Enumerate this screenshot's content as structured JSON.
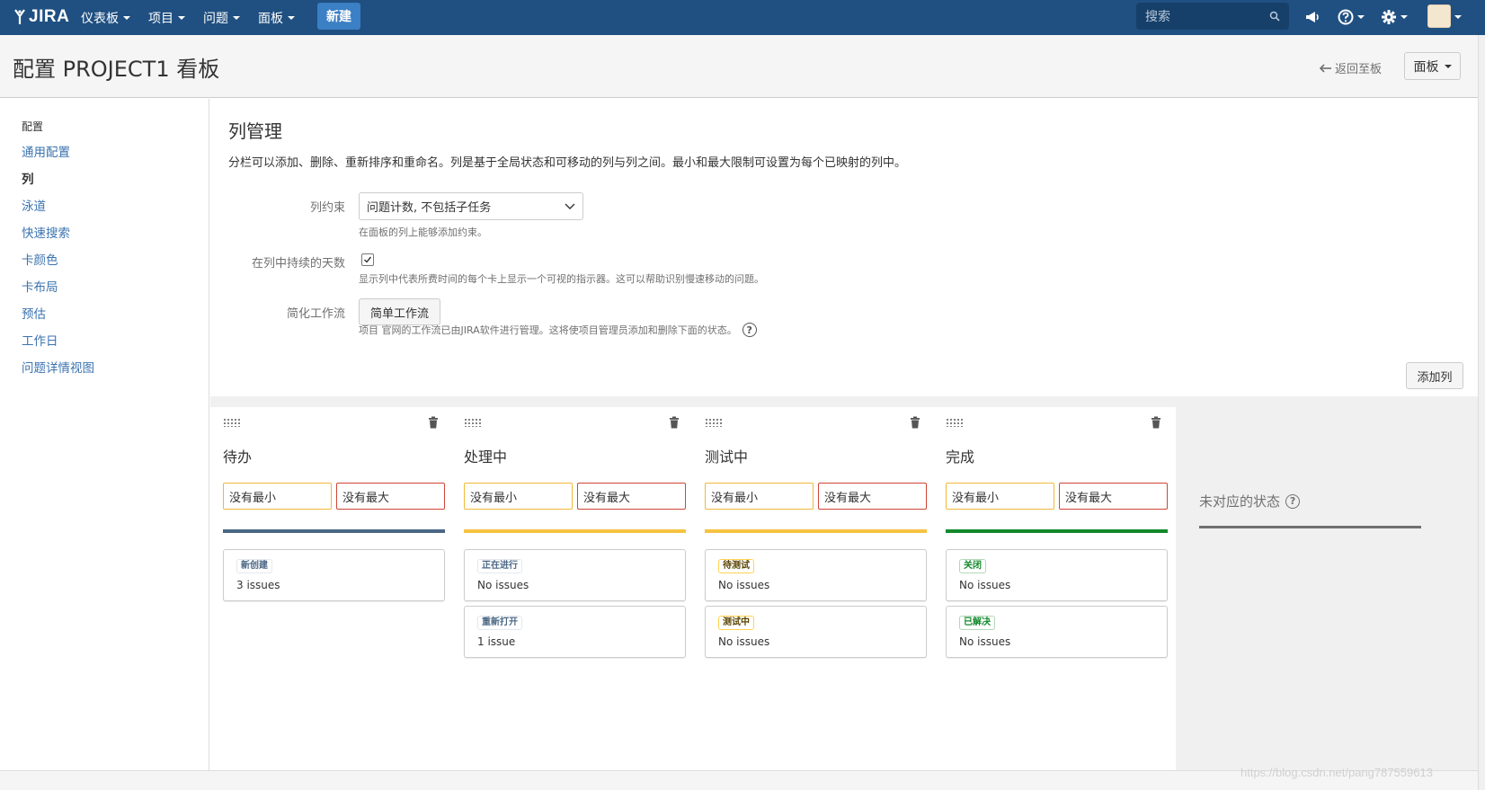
{
  "topnav": {
    "logo": "JIRA",
    "menu": [
      {
        "label": "仪表板"
      },
      {
        "label": "项目"
      },
      {
        "label": "问题"
      },
      {
        "label": "面板"
      }
    ],
    "create_label": "新建",
    "search_placeholder": "搜索"
  },
  "header": {
    "title": "配置 PROJECT1 看板",
    "back_link": "返回至板",
    "board_button": "面板"
  },
  "sidebar": {
    "heading": "配置",
    "items": [
      {
        "label": "通用配置"
      },
      {
        "label": "列"
      },
      {
        "label": "泳道"
      },
      {
        "label": "快速搜索"
      },
      {
        "label": "卡颜色"
      },
      {
        "label": "卡布局"
      },
      {
        "label": "预估"
      },
      {
        "label": "工作日"
      },
      {
        "label": "问题详情视图"
      }
    ]
  },
  "main": {
    "title": "列管理",
    "description": "分栏可以添加、删除、重新排序和重命名。列是基于全局状态和可移动的列与列之间。最小和最大限制可设置为每个已映射的列中。",
    "constraint_label": "列约束",
    "constraint_value": "问题计数, 不包括子任务",
    "constraint_help": "在面板的列上能够添加约束。",
    "days_label": "在列中持续的天数",
    "days_help": "显示列中代表所费时间的每个卡上显示一个可视的指示器。这可以帮助识别慢速移动的问题。",
    "simplify_label": "简化工作流",
    "simplify_button": "简单工作流",
    "simplify_help": "项目 官网的工作流已由JIRA软件进行管理。这将使项目管理员添加和删除下面的状态。",
    "add_column": "添加列"
  },
  "columns": [
    {
      "name": "待办",
      "min": "没有最小",
      "max": "没有最大",
      "bar_color": "#4a6785",
      "statuses": [
        {
          "name": "新创建",
          "count": "3 issues",
          "tone": "blue"
        }
      ]
    },
    {
      "name": "处理中",
      "min": "没有最小",
      "max": "没有最大",
      "bar_color": "#f6c342",
      "statuses": [
        {
          "name": "正在进行",
          "count": "No issues",
          "tone": "blue"
        },
        {
          "name": "重新打开",
          "count": "1 issue",
          "tone": "blue"
        }
      ]
    },
    {
      "name": "测试中",
      "min": "没有最小",
      "max": "没有最大",
      "bar_color": "#f6c342",
      "statuses": [
        {
          "name": "待测试",
          "count": "No issues",
          "tone": "yellow"
        },
        {
          "name": "测试中",
          "count": "No issues",
          "tone": "yellow"
        }
      ]
    },
    {
      "name": "完成",
      "min": "没有最小",
      "max": "没有最大",
      "bar_color": "#14892c",
      "statuses": [
        {
          "name": "关闭",
          "count": "No issues",
          "tone": "green"
        },
        {
          "name": "已解决",
          "count": "No issues",
          "tone": "green"
        }
      ]
    }
  ],
  "unmapped": {
    "title": "未对应的状态"
  },
  "watermark": "https://blog.csdn.net/pang787559613"
}
